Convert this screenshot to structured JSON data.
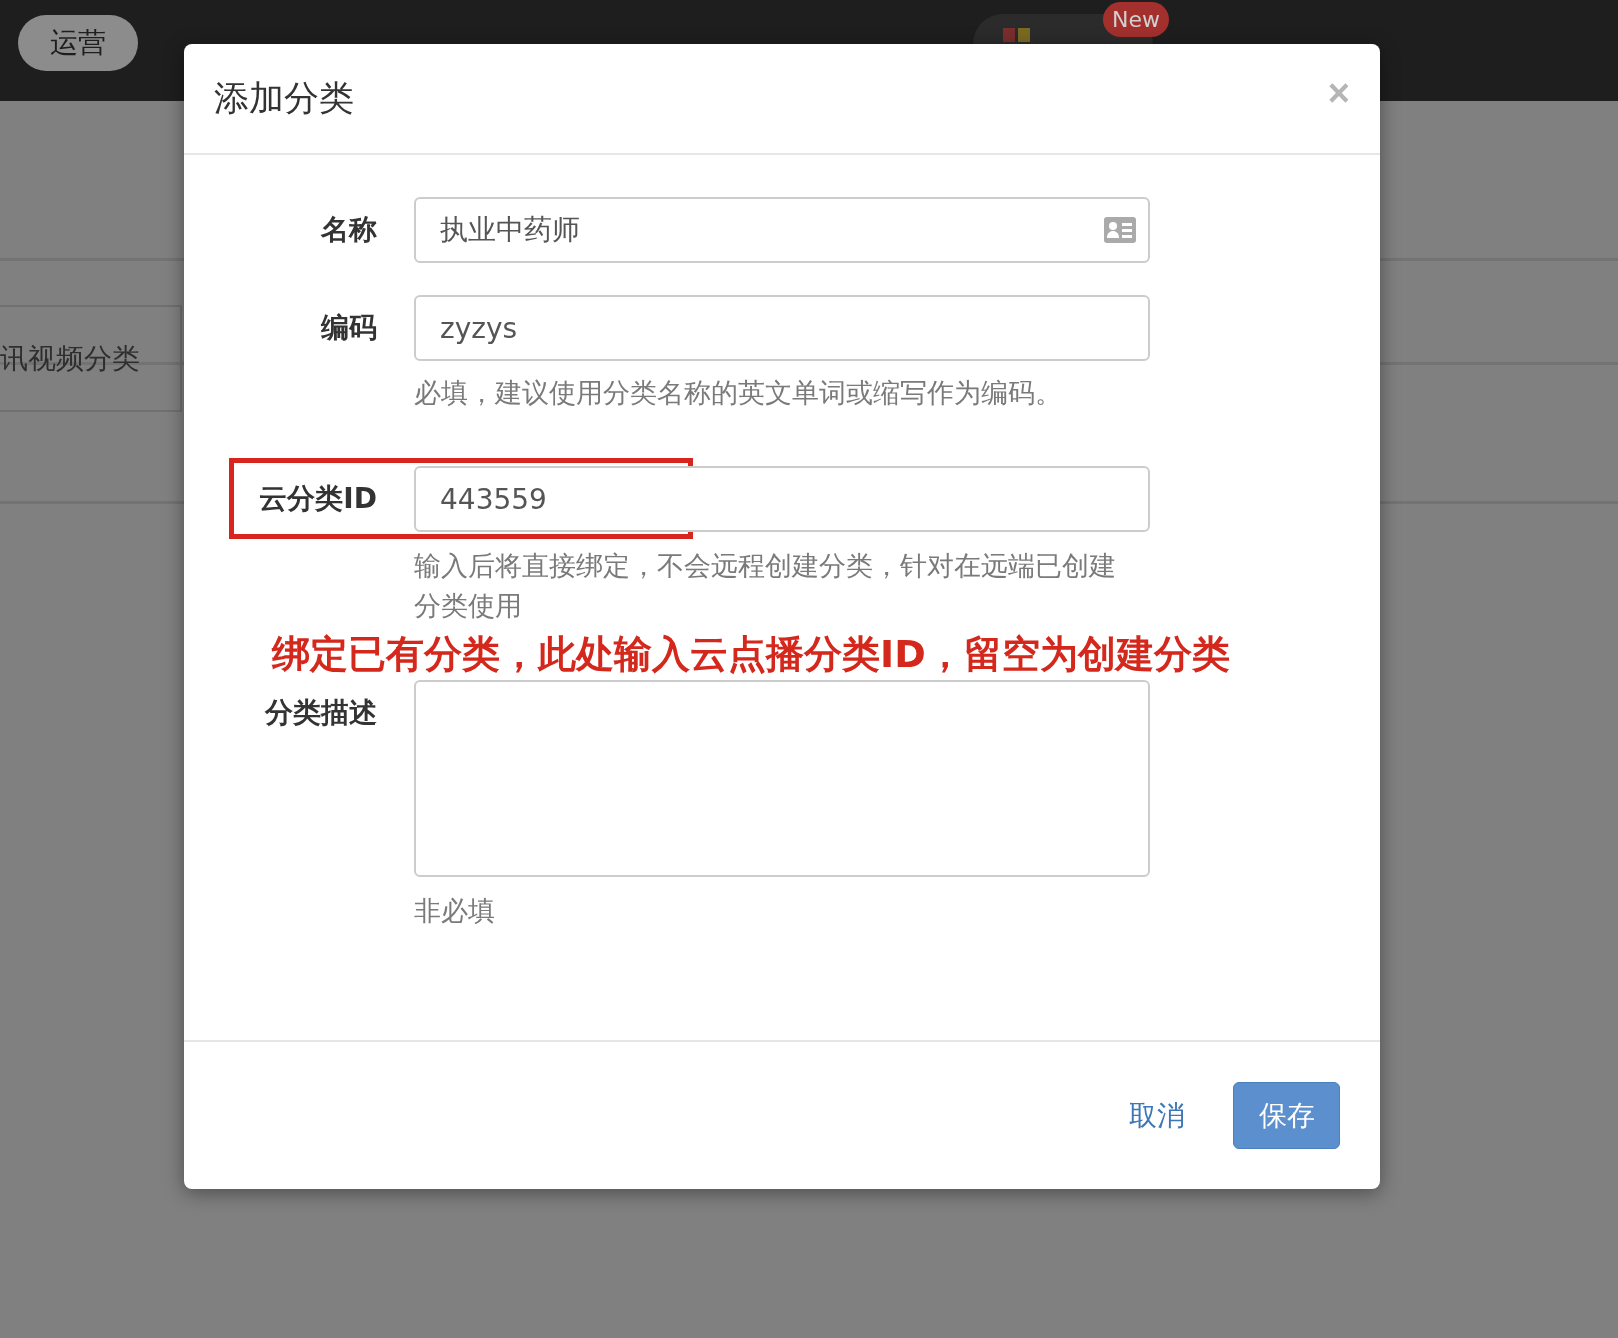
{
  "nav": {
    "active": "运营",
    "badge": "New"
  },
  "background": {
    "row_label": "讯视频分类"
  },
  "modal": {
    "title": "添加分类",
    "close": "×",
    "fields": [
      {
        "kind": "input",
        "label": "名称",
        "value": "执业中药师",
        "has_icon": true,
        "highlighted": false
      },
      {
        "kind": "input",
        "label": "编码",
        "value": "zyzys",
        "help": "必填，建议使用分类名称的英文单词或缩写作为编码。",
        "highlighted": false
      },
      {
        "kind": "input",
        "label": "云分类ID",
        "value": "443559",
        "help": "输入后将直接绑定，不会远程创建分类，针对在远端已创建分类使用",
        "highlighted": true,
        "annotation": "绑定已有分类，此处输入云点播分类ID，留空为创建分类"
      },
      {
        "kind": "textarea",
        "label": "分类描述",
        "help": "非必填",
        "highlighted": false
      }
    ],
    "buttons": [
      {
        "kind": "link",
        "label": "取消"
      },
      {
        "kind": "primary",
        "label": "保存"
      }
    ]
  }
}
